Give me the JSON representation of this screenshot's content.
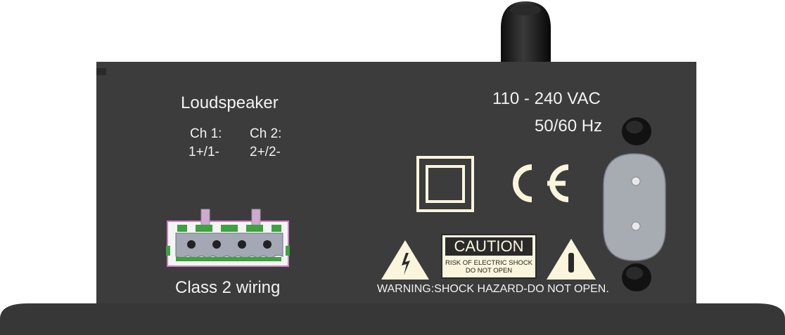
{
  "speaker": {
    "title": "Loudspeaker",
    "ch1_label": "Ch 1:",
    "ch1_pins": "1+/1-",
    "ch2_label": "Ch 2:",
    "ch2_pins": "2+/2-",
    "wiring_label": "Class 2 wiring"
  },
  "power": {
    "voltage": "110 - 240 VAC",
    "frequency": "50/60 Hz"
  },
  "certification": {
    "ce_mark": "CE",
    "class2_symbol": "double-square-icon"
  },
  "caution": {
    "title": "CAUTION",
    "line1": "RISK OF ELECTRIC SHOCK",
    "line2": "DO NOT OPEN",
    "warning": "WARNING:SHOCK HAZARD-DO NOT OPEN."
  },
  "icons": {
    "shock": "lightning-warning-icon",
    "attention": "exclamation-warning-icon",
    "knob": "rotary-knob-icon",
    "connector": "speaker-connector-icon",
    "inlet": "power-inlet-icon"
  },
  "colors": {
    "panel": "#3c3c3c",
    "label_fill": "#fbf5dc",
    "connector_green": "#3fa13f",
    "connector_pink": "#c880c0"
  }
}
